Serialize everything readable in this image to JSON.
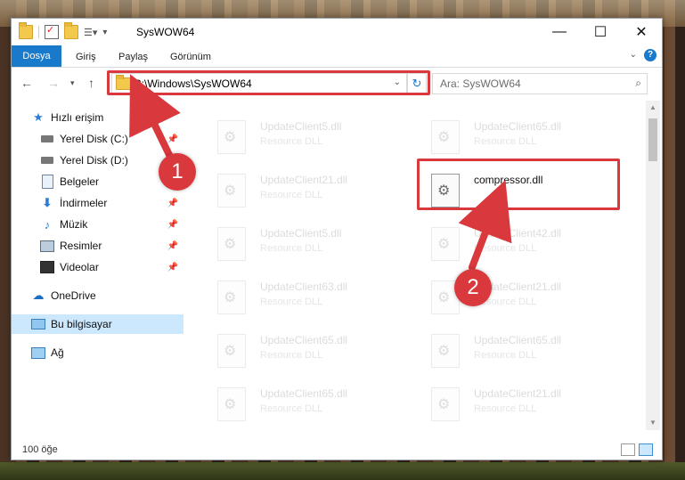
{
  "window": {
    "title": "SysWOW64",
    "controls": {
      "minimize": "—",
      "maximize": "☐",
      "close": "✕"
    }
  },
  "ribbon": {
    "tabs": [
      "Dosya",
      "Giriş",
      "Paylaş",
      "Görünüm"
    ],
    "help": "?"
  },
  "navbar": {
    "address": "C:\\Windows\\SysWOW64",
    "search_placeholder": "Ara: SysWOW64"
  },
  "sidebar": {
    "items": [
      {
        "label": "Hızlı erişim",
        "icon": "star-icon",
        "pinned": false
      },
      {
        "label": "Yerel Disk (C:)",
        "icon": "disk-icon",
        "pinned": true
      },
      {
        "label": "Yerel Disk (D:)",
        "icon": "disk-icon",
        "pinned": true
      },
      {
        "label": "Belgeler",
        "icon": "document-icon",
        "pinned": true
      },
      {
        "label": "İndirmeler",
        "icon": "download-icon",
        "pinned": true
      },
      {
        "label": "Müzik",
        "icon": "music-icon",
        "pinned": true
      },
      {
        "label": "Resimler",
        "icon": "picture-icon",
        "pinned": true
      },
      {
        "label": "Videolar",
        "icon": "video-icon",
        "pinned": true
      },
      {
        "label": "OneDrive",
        "icon": "cloud-icon",
        "pinned": false
      },
      {
        "label": "Bu bilgisayar",
        "icon": "computer-icon",
        "pinned": false,
        "selected": true
      },
      {
        "label": "Ağ",
        "icon": "network-icon",
        "pinned": false
      }
    ]
  },
  "files": [
    {
      "name": "UpdateClient5.dll",
      "type": "Resource DLL"
    },
    {
      "name": "UpdateClient65.dll",
      "type": "Resource DLL"
    },
    {
      "name": "UpdateClient21.dll",
      "type": "Resource DLL"
    },
    {
      "name": "compressor.dll",
      "type": ""
    },
    {
      "name": "UpdateClient5.dll",
      "type": "Resource DLL"
    },
    {
      "name": "UpdateClient42.dll",
      "type": "Resource DLL"
    },
    {
      "name": "UpdateClient63.dll",
      "type": "Resource DLL"
    },
    {
      "name": "UpdateClient21.dll",
      "type": "Resource DLL"
    },
    {
      "name": "UpdateClient65.dll",
      "type": "Resource DLL"
    },
    {
      "name": "UpdateClient65.dll",
      "type": "Resource DLL"
    },
    {
      "name": "UpdateClient65.dll",
      "type": "Resource DLL"
    },
    {
      "name": "UpdateClient21.dll",
      "type": "Resource DLL"
    }
  ],
  "status": {
    "count": "100 öğe"
  },
  "annotations": {
    "step1": "1",
    "step2": "2",
    "color": "#d9383d"
  }
}
